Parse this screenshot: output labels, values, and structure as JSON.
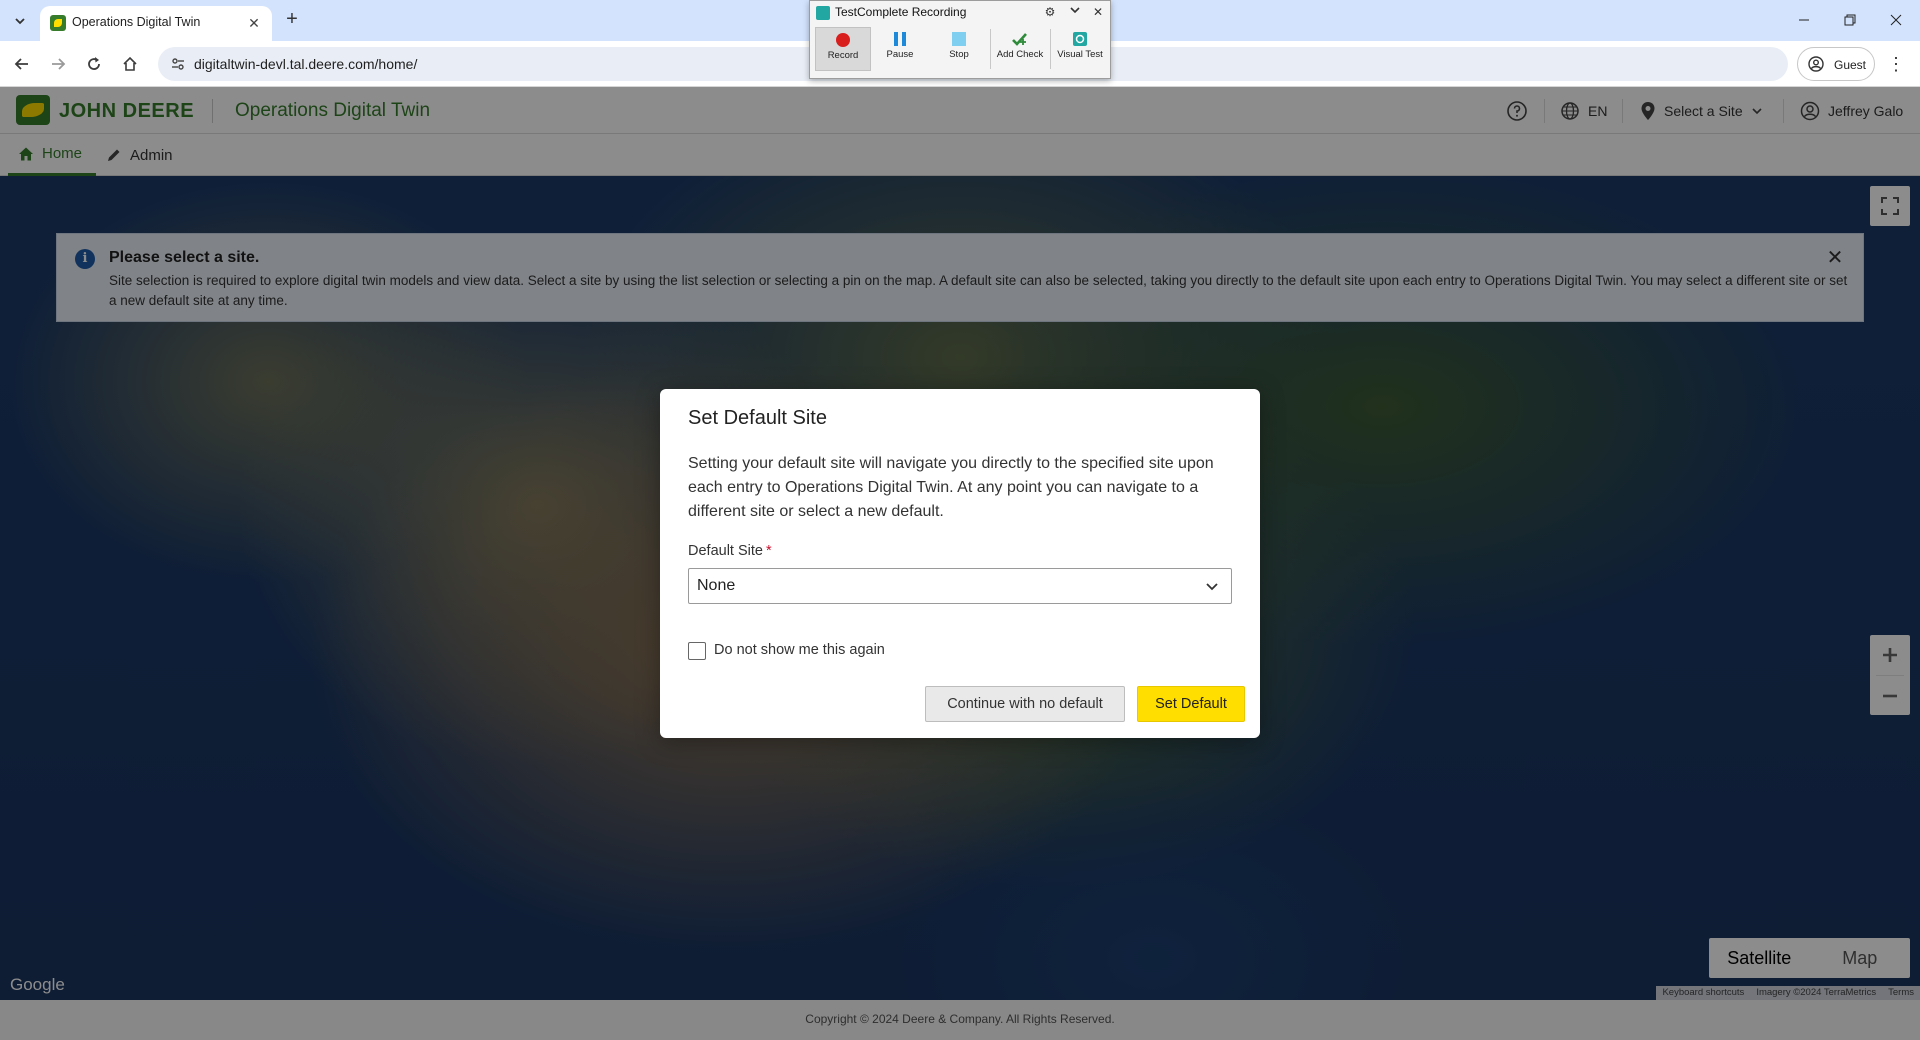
{
  "browser": {
    "tab_title": "Operations Digital Twin",
    "url": "digitaltwin-devl.tal.deere.com/home/",
    "profile_label": "Guest"
  },
  "testcomplete": {
    "title": "TestComplete Recording",
    "buttons": {
      "record": "Record",
      "pause": "Pause",
      "stop": "Stop",
      "add_check": "Add Check",
      "visual_test": "Visual Test"
    }
  },
  "header": {
    "brand": "JOHN DEERE",
    "app_title": "Operations Digital Twin",
    "language": "EN",
    "site_selector": "Select a Site",
    "user_name": "Jeffrey Galo"
  },
  "nav": {
    "tabs": [
      {
        "label": "Home",
        "active": true
      },
      {
        "label": "Admin",
        "active": false
      }
    ]
  },
  "banner": {
    "title": "Please select a site.",
    "text": "Site selection is required to explore digital twin models and view data. Select a site by using the list selection or selecting a pin on the map. A default site can also be selected, taking you directly to the default site upon each entry to Operations Digital Twin. You may select a different site or set a new default site at any time."
  },
  "map": {
    "type_options": [
      "Satellite",
      "Map"
    ],
    "selected_type": "Satellite",
    "google_mark": "Google",
    "attribution": [
      "Keyboard shortcuts",
      "Imagery ©2024 TerraMetrics",
      "Terms"
    ]
  },
  "modal": {
    "title": "Set Default Site",
    "body": "Setting your default site will navigate you directly to the specified site upon each entry to Operations Digital Twin. At any point you can navigate to a different site or select a new default.",
    "field_label": "Default Site",
    "required_mark": "*",
    "select_value": "None",
    "checkbox_label": "Do not show me this again",
    "checkbox_checked": false,
    "secondary_button": "Continue with no default",
    "primary_button": "Set Default"
  },
  "footer": {
    "copyright": "Copyright © 2024 Deere & Company. All Rights Reserved."
  },
  "colors": {
    "brand_green": "#367c2b",
    "brand_yellow": "#ffde00"
  }
}
